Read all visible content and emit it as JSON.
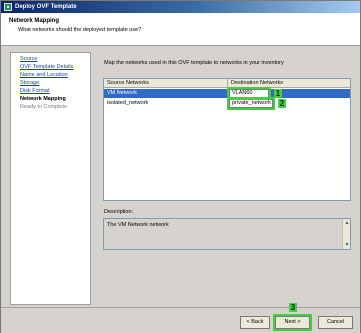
{
  "window": {
    "title": "Deploy OVF Template"
  },
  "header": {
    "title": "Network Mapping",
    "subtitle": "What networks should the deployed template use?"
  },
  "sidebar": {
    "steps": [
      {
        "label": "Source",
        "state": "link"
      },
      {
        "label": "OVF Template Details",
        "state": "link"
      },
      {
        "label": "Name and Location",
        "state": "link"
      },
      {
        "label": "Storage",
        "state": "link"
      },
      {
        "label": "Disk Format",
        "state": "link"
      },
      {
        "label": "Network Mapping",
        "state": "current"
      },
      {
        "label": "Ready to Complete",
        "state": "future"
      }
    ]
  },
  "main": {
    "intro": "Map the networks used in this OVF template to networks in your inventory",
    "table": {
      "columns": [
        "Source Networks",
        "Destination Networks"
      ],
      "rows": [
        {
          "source": "VM Network",
          "destination": "VLAN60",
          "selected": true
        },
        {
          "source": "isolated_network",
          "destination": "private_network",
          "selected": false
        }
      ]
    },
    "description_label": "Description:",
    "description_text": "The VM Network network"
  },
  "annotations": {
    "badge1": "1",
    "badge2": "2",
    "badge3": "3",
    "highlight_color": "#3fcf3f"
  },
  "footer": {
    "back": "< Back",
    "next": "Next >",
    "cancel": "Cancel"
  },
  "colors": {
    "title_bar": "#0a246a",
    "selection": "#316ac5",
    "link": "#1a3fb5"
  }
}
